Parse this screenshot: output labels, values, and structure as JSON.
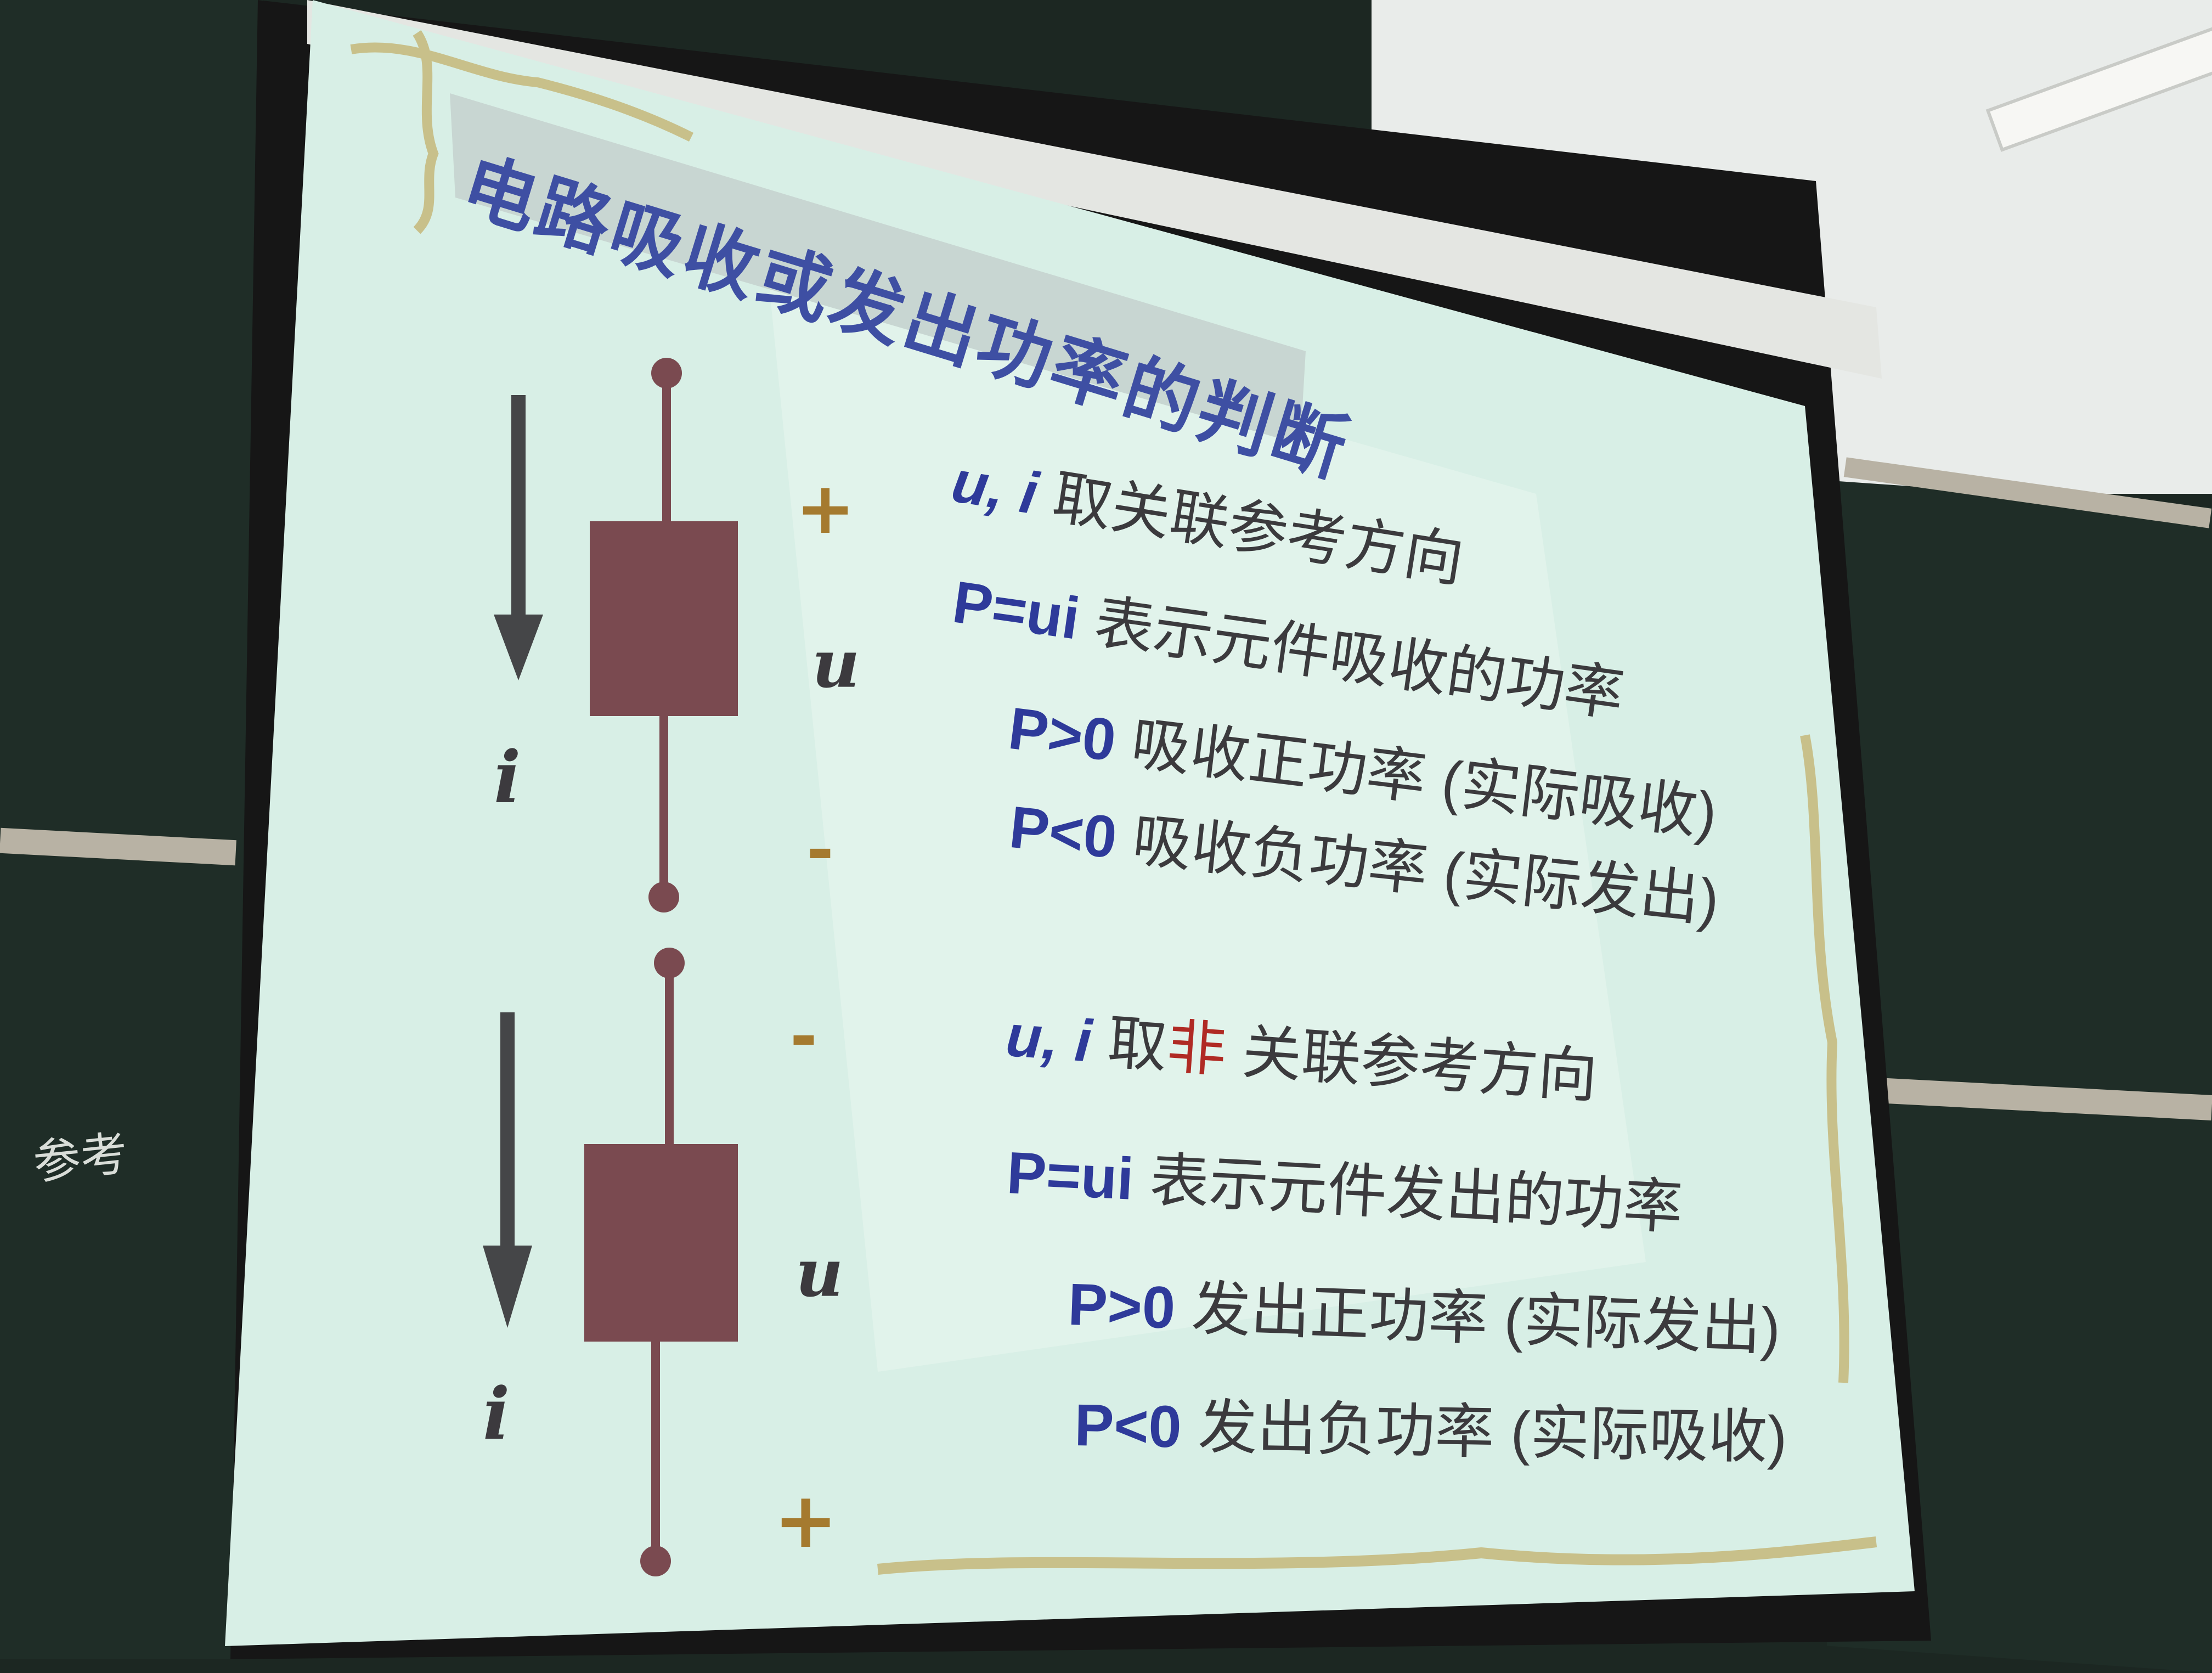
{
  "slide": {
    "title": "电路吸收或发出功率的判断",
    "section1": {
      "line1_vars": "u, i",
      "line1_rest": "取关联参考方向",
      "line2_formula": "P=ui",
      "line2_rest": "表示元件吸收的功率",
      "line3_cond": "P>0",
      "line3_rest": "吸收正功率 (实际吸收)",
      "line4_cond": "P<0",
      "line4_rest": "吸收负功率 (实际发出)"
    },
    "section2": {
      "line1_vars": "u, i",
      "line1_take": "取",
      "line1_emph": "非",
      "line1_rest": "关联参考方向",
      "line2_formula": "P=ui",
      "line2_rest": "表示元件发出的功率",
      "line3_cond": "P>0",
      "line3_rest": "发出正功率 (实际发出)",
      "line4_cond": "P<0",
      "line4_rest": "发出负功率 (实际吸收)"
    },
    "diagram1": {
      "current_label": "i",
      "voltage_label": "u",
      "top_mark": "+",
      "bottom_mark": "-"
    },
    "diagram2": {
      "current_label": "i",
      "voltage_label": "u",
      "top_mark": "-",
      "bottom_mark": "+"
    }
  },
  "chalkboard": {
    "handwriting": "参考"
  },
  "colors": {
    "slide_background": "#d9efe6",
    "text_blue": "#2e3a9a",
    "element_box": "#7a4a50",
    "sign_marks": "#a57a2f",
    "emphasis_red": "#b02a24"
  }
}
